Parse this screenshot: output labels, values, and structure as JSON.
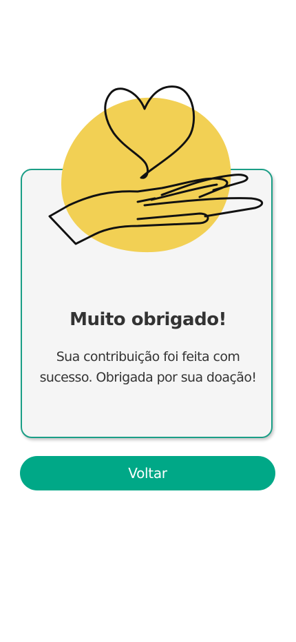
{
  "success": {
    "illustration": "hand-holding-heart-icon",
    "title": "Muito obrigado!",
    "message": "Sua contribuição foi feita com sucesso. Obrigada por sua doação!",
    "button_label": "Voltar"
  },
  "colors": {
    "accent": "#00a887",
    "card_border": "#1a9e86",
    "card_background": "#f5f5f5",
    "blob": "#f2d054",
    "text": "#333333"
  }
}
